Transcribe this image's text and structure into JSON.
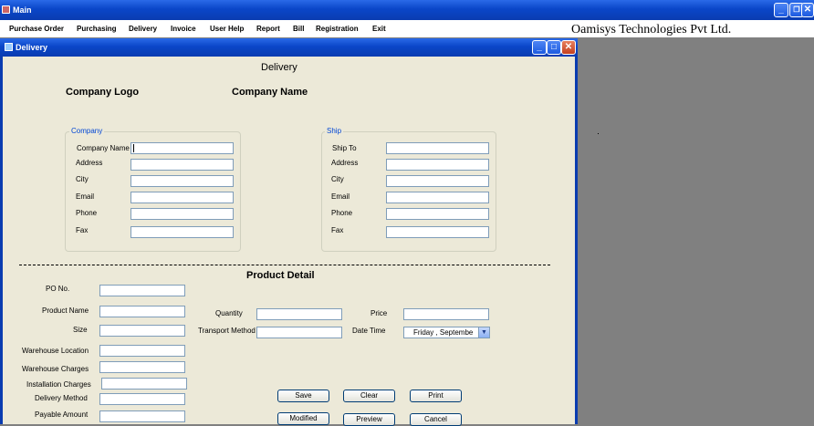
{
  "main_window": {
    "title": "Main",
    "controls": {
      "minimize": "_",
      "maximize": "❐",
      "close": "✕"
    }
  },
  "menu": [
    "Purchase Order",
    "Purchasing",
    "Delivery",
    "Invoice",
    "User Help",
    "Report",
    "Bill",
    "Registration",
    "Exit"
  ],
  "banner": "Oamisys Technologies Pvt Ltd.",
  "child_window": {
    "title": "Delivery",
    "controls": {
      "minimize": "_",
      "maximize": "□",
      "close": "✕"
    }
  },
  "form": {
    "heading": "Delivery",
    "logo_label": "Company Logo",
    "company_name_label": "Company Name",
    "company_group": {
      "title": "Company",
      "fields": [
        "Company Name",
        "Address",
        "City",
        "Email",
        "Phone",
        "Fax"
      ]
    },
    "ship_group": {
      "title": "Ship",
      "fields": [
        "Ship To",
        "Address",
        "City",
        "Email",
        "Phone",
        "Fax"
      ]
    },
    "product_heading": "Product Detail",
    "product_left_fields": [
      "PO No.",
      "Product Name",
      "Size",
      "Warehouse Location",
      "Warehouse Charges",
      "Installation Charges",
      "Delivery Method",
      "Payable Amount"
    ],
    "quantity_label": "Quantity",
    "transport_label": "Transport Method",
    "price_label": "Price",
    "datetime_label": "Date  Time",
    "date_value": "Friday     , Septembe",
    "buttons": [
      "Save",
      "Clear",
      "Print",
      "Modified",
      "Preview",
      "Cancel"
    ]
  }
}
